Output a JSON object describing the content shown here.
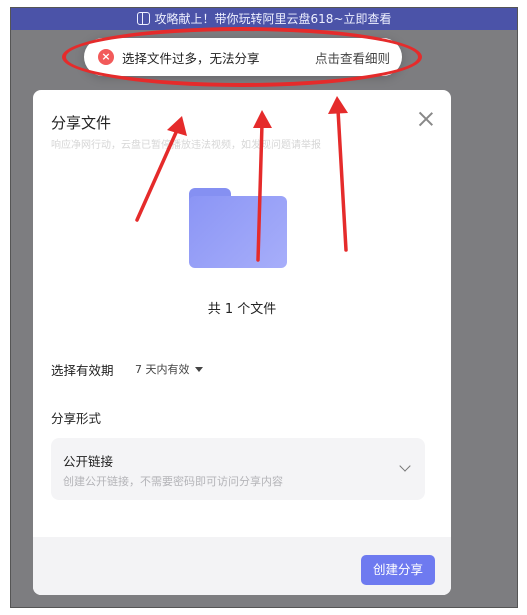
{
  "banner": {
    "text": "攻略献上！带你玩转阿里云盘618~立即查看",
    "icon": "gift-icon"
  },
  "toast": {
    "message": "选择文件过多，无法分享",
    "link": "点击查看细则",
    "icon": "error-icon",
    "color": "#f25a5a"
  },
  "dialog": {
    "title": "分享文件",
    "subtitle": "响应净网行动，云盘已暂停播放违法视频，如发现问题请举报",
    "file_count": "共 1 个文件",
    "expiry": {
      "label": "选择有效期",
      "value": "7 天内有效"
    },
    "share_form": {
      "label": "分享形式"
    },
    "option": {
      "title": "公开链接",
      "description": "创建公开链接，不需要密码即可访问分享内容"
    },
    "create_button": "创建分享"
  },
  "colors": {
    "accent": "#6e7af0",
    "banner": "#4b53a8",
    "annotation": "#e52b2b"
  }
}
